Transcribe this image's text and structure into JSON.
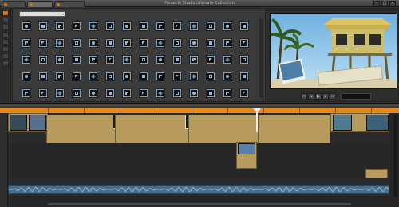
{
  "window": {
    "title": "Pinnacle Studio Ultimate Collection",
    "tabs": [
      {
        "label": "",
        "active": false
      },
      {
        "label": "",
        "active": true
      },
      {
        "label": "",
        "active": false
      }
    ],
    "controls": [
      "minimize-icon",
      "maximize-icon",
      "close-icon"
    ]
  },
  "library": {
    "category_dropdown": "",
    "tile_icon": "transition-thumbnail"
  },
  "preview": {
    "caption": "",
    "timecode": "",
    "buttons": [
      "go-to-start-icon",
      "step-back-icon",
      "play-icon",
      "step-forward-icon",
      "go-to-end-icon"
    ]
  },
  "timeline": {
    "project_name": "",
    "ruler_ticks": [
      "",
      "",
      "",
      "",
      "",
      "",
      "",
      "",
      "",
      ""
    ],
    "clips": [
      {
        "label": ""
      },
      {
        "label": ""
      },
      {
        "label": ""
      },
      {
        "label": ""
      }
    ],
    "title_clip": "",
    "audio_clip": ""
  },
  "colors": {
    "ruler": "#e88a1a",
    "clip": "#b69a5e",
    "accent": "#c87a2a"
  }
}
